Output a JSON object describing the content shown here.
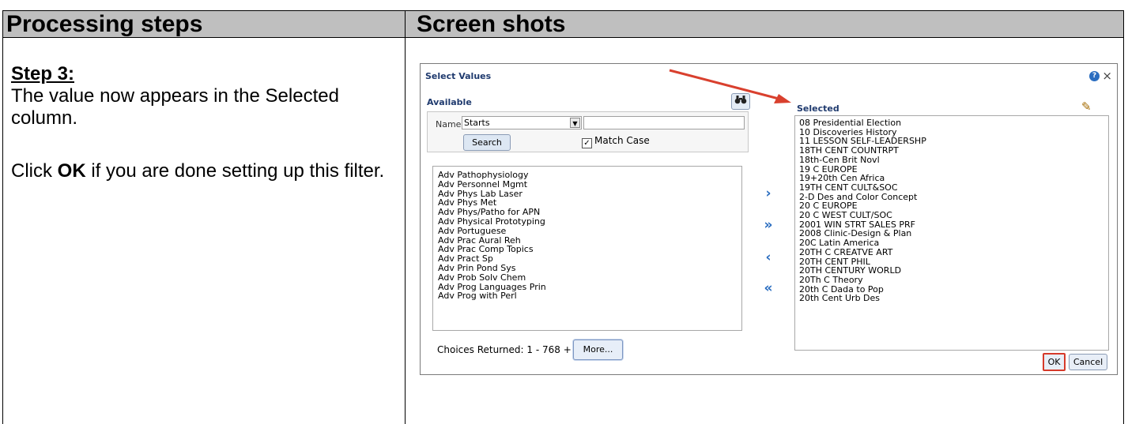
{
  "table": {
    "header_left": "Processing steps",
    "header_right": "Screen shots"
  },
  "instructions": {
    "step_title": "Step 3:",
    "text1": "The value now appears in the Selected column.",
    "text2_prefix": "Click ",
    "text2_bold": "OK",
    "text2_suffix": " if you are done setting up this filter."
  },
  "dialog": {
    "title": "Select Values",
    "help_icon": "?",
    "close_icon": "×",
    "available_label": "Available",
    "name_label": "Name",
    "operator_value": "Starts",
    "search_value": "",
    "search_button": "Search",
    "match_case_label": "Match Case",
    "match_case_checked": true,
    "available_items": [
      "Adv Pathophysiology",
      "Adv Personnel Mgmt",
      "Adv Phys Lab Laser",
      "Adv Phys Met",
      "Adv Phys/Patho for APN",
      "Adv Physical Prototyping",
      "Adv Portuguese",
      "Adv Prac Aural Reh",
      "Adv Prac Comp Topics",
      "Adv Pract Sp",
      "Adv Prin Pond Sys",
      "Adv Prob Solv Chem",
      "Adv Prog Languages Prin",
      "Adv Prog with Perl"
    ],
    "choices_returned": "Choices Returned: 1 - 768 +",
    "more_button": "More...",
    "shuttle": {
      "move": "›",
      "move_all": "»",
      "remove": "‹",
      "remove_all": "«"
    },
    "selected_label": "Selected",
    "selected_items": [
      "08 Presidential Election",
      "10 Discoveries History",
      "11 LESSON SELF-LEADERSHP",
      "18TH CENT COUNTRPT",
      "18th-Cen Brit Novl",
      "19 C EUROPE",
      "19+20th Cen Africa",
      "19TH CENT CULT&SOC",
      "2-D Des and Color Concept",
      "20 C EUROPE",
      "20 C WEST CULT/SOC",
      "2001 WIN STRT SALES PRF",
      "2008 Clinic-Design & Plan",
      "20C Latin America",
      "20TH C CREATVE ART",
      "20TH CENT PHIL",
      "20TH CENTURY WORLD",
      "20Th C Theory",
      "20th C Dada to Pop",
      "20th Cent Urb Des"
    ],
    "ok_button": "OK",
    "cancel_button": "Cancel",
    "icons": {
      "binoculars": "binoculars-icon",
      "pencil": "pencil-icon"
    },
    "colors": {
      "accent": "#2a6dc0",
      "highlight": "#d63a2a",
      "header_fill": "#bfbfbf"
    }
  }
}
